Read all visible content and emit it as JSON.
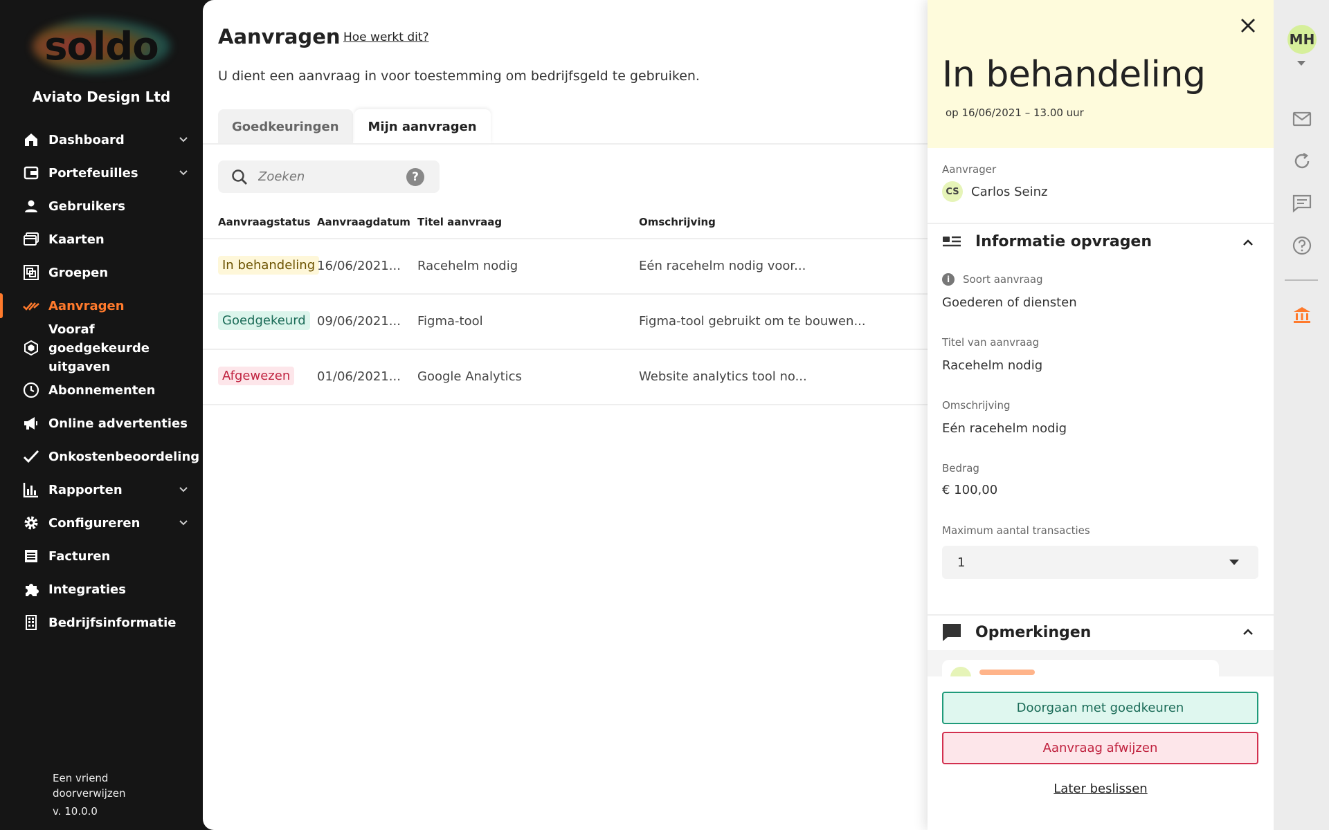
{
  "brand": {
    "logo_text": "soldo",
    "company": "Aviato Design Ltd",
    "accent": "#ff7a2c"
  },
  "nav": {
    "items": [
      {
        "label": "Dashboard",
        "icon": "home-icon",
        "chevron": true
      },
      {
        "label": "Portefeuilles",
        "icon": "wallet-icon",
        "chevron": true
      },
      {
        "label": "Gebruikers",
        "icon": "user-icon",
        "chevron": false
      },
      {
        "label": "Kaarten",
        "icon": "cards-icon",
        "chevron": false
      },
      {
        "label": "Groepen",
        "icon": "groups-icon",
        "chevron": false
      },
      {
        "label": "Aanvragen",
        "icon": "requests-icon",
        "chevron": false,
        "active": true
      },
      {
        "label": "Vooraf goedgekeurde uitgaven",
        "icon": "hexagon-icon",
        "chevron": false
      },
      {
        "label": "Abonnementen",
        "icon": "clock-icon",
        "chevron": false
      },
      {
        "label": "Online advertenties",
        "icon": "megaphone-icon",
        "chevron": false
      },
      {
        "label": "Onkostenbeoordeling",
        "icon": "checkmark-icon",
        "chevron": false
      },
      {
        "label": "Rapporten",
        "icon": "bar-chart-icon",
        "chevron": true
      },
      {
        "label": "Configureren",
        "icon": "gear-icon",
        "chevron": true
      },
      {
        "label": "Facturen",
        "icon": "invoice-icon",
        "chevron": false
      },
      {
        "label": "Integraties",
        "icon": "puzzle-icon",
        "chevron": false
      },
      {
        "label": "Bedrijfsinformatie",
        "icon": "building-icon",
        "chevron": false
      }
    ],
    "footer_refer": "Een vriend doorverwijzen",
    "footer_version": "v. 10.0.0"
  },
  "main": {
    "title": "Aanvragen",
    "help_link": "Hoe werkt dit?",
    "subtitle": "U dient een aanvraag in voor toestemming om bedrijfsgeld te gebruiken.",
    "tabs": [
      {
        "label": "Goedkeuringen",
        "active": false
      },
      {
        "label": "Mijn aanvragen",
        "active": true
      }
    ],
    "search": {
      "placeholder": "Zoeken",
      "help": "?"
    },
    "table": {
      "headers": [
        "Aanvraagstatus",
        "Aanvraagdatum",
        "Titel aanvraag",
        "Omschrijving"
      ],
      "rows": [
        {
          "status": "In behandeling",
          "date": "16/06/2021...",
          "title": "Racehelm nodig",
          "description": "Eén racehelm nodig voor..."
        },
        {
          "status": "Goedgekeurd",
          "date": "09/06/2021...",
          "title": "Figma-tool",
          "description": "Figma-tool gebruikt om te bouwen..."
        },
        {
          "status": "Afgewezen",
          "date": "01/06/2021...",
          "title": "Google Analytics",
          "description": "Website analytics tool no..."
        }
      ]
    },
    "status_colors": {
      "pending_bg": "#fef7d9",
      "pending_fg": "#6b5200",
      "approved_bg": "#dcf5ec",
      "approved_fg": "#1a6b57",
      "rejected_bg": "#fde6ea",
      "rejected_fg": "#c0223f"
    }
  },
  "drawer": {
    "status_title": "In behandeling",
    "status_date": "op 16/06/2021 – 13.00 uur",
    "requester_label": "Aanvrager",
    "requester_initials": "CS",
    "requester_name": "Carlos Seinz",
    "info_section": "Informatie opvragen",
    "fields": [
      {
        "label": "Soort aanvraag",
        "value": "Goederen of diensten"
      },
      {
        "label": "Titel van aanvraag",
        "value": "Racehelm nodig"
      },
      {
        "label": "Omschrijving",
        "value": "Eén racehelm nodig"
      },
      {
        "label": "Bedrag",
        "value": "€ 100,00"
      }
    ],
    "max_tx_label": "Maximum aantal transacties",
    "max_tx_value": "1",
    "comments_section": "Opmerkingen",
    "approve_label": "Doorgaan met goedkeuren",
    "reject_label": "Aanvraag afwijzen",
    "later_label": "Later beslissen"
  },
  "rail": {
    "user_initials": "MH",
    "icons": [
      "mail-icon",
      "refresh-icon",
      "chat-icon",
      "help-icon",
      "bank-icon"
    ]
  }
}
